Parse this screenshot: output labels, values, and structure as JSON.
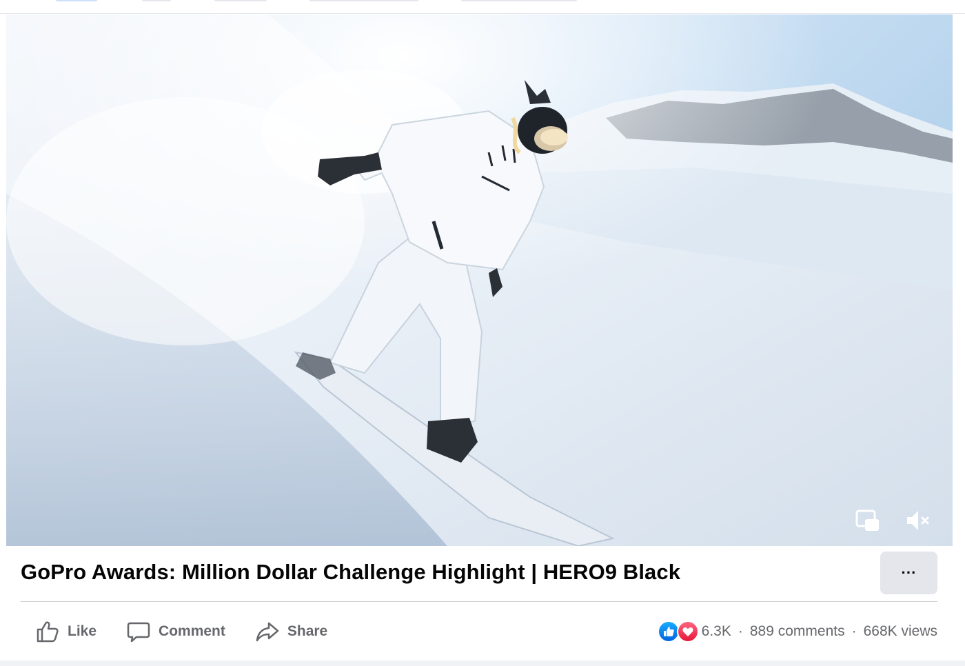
{
  "post": {
    "title": "GoPro Awards: Million Dollar Challenge Highlight | HERO9 Black",
    "more_label": "···"
  },
  "video": {
    "controls": {
      "miniplayer_icon": "picture-in-picture-icon",
      "mute_icon": "speaker-muted-icon"
    }
  },
  "actions": {
    "like_label": "Like",
    "comment_label": "Comment",
    "share_label": "Share"
  },
  "stats": {
    "reaction_icons": [
      "like-reaction-icon",
      "love-reaction-icon"
    ],
    "reactions_count": "6.3K",
    "separator": "·",
    "comments": "889 comments",
    "views": "668K views"
  },
  "colors": {
    "text_primary": "#050505",
    "text_secondary": "#65676b",
    "button_bg": "#e4e6eb",
    "like_blue": "#0866ff",
    "love_red": "#f33e58"
  }
}
